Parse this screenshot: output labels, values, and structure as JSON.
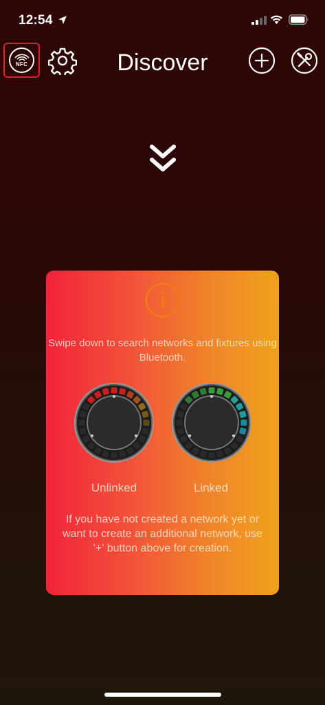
{
  "status_bar": {
    "time": "12:54",
    "icons": [
      "location-arrow-icon",
      "cellular-signal-icon",
      "wifi-icon",
      "battery-icon"
    ]
  },
  "nav": {
    "nfc_label": "NFC",
    "title": "Discover",
    "icons": [
      "nfc-icon",
      "gear-icon",
      "plus-circle-icon",
      "tools-icon"
    ]
  },
  "pull_hint_icon": "double-chevron-down-icon",
  "info_card": {
    "icon": "info-icon",
    "swipe_text": "Swipe down to search networks and fixtures using Bluetooth.",
    "unlinked_label": "Unlinked",
    "linked_label": "Linked",
    "create_text": "If you have not created a network yet or want to create an additional network, use '+' button above for creation."
  },
  "colors": {
    "card_left": "#f2243a",
    "card_right": "#f0a21c",
    "info_icon": "#f07a1a",
    "nfc_highlight": "#e0202a"
  }
}
